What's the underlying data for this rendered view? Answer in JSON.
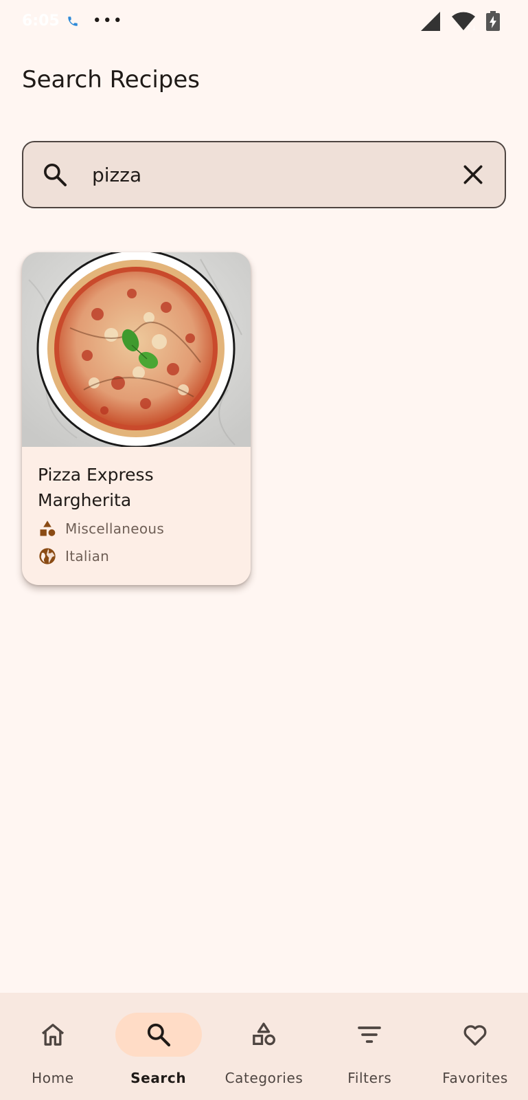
{
  "status_bar": {
    "time": "6:05",
    "call_icon": "phone-call-icon",
    "more_icon": "more-dots-icon",
    "signal_icon": "cell-signal-icon",
    "wifi_icon": "wifi-icon",
    "battery_icon": "battery-charging-icon"
  },
  "header": {
    "title": "Search Recipes"
  },
  "search": {
    "value": "pizza",
    "search_icon": "search-icon",
    "clear_icon": "close-icon"
  },
  "results": [
    {
      "title": "Pizza Express Margherita",
      "category": "Miscellaneous",
      "category_icon": "category-shapes-icon",
      "area": "Italian",
      "area_icon": "globe-icon"
    }
  ],
  "bottom_nav": {
    "items": [
      {
        "label": "Home",
        "icon": "home-icon",
        "active": false
      },
      {
        "label": "Search",
        "icon": "search-icon",
        "active": true
      },
      {
        "label": "Categories",
        "icon": "category-shapes-icon",
        "active": false
      },
      {
        "label": "Filters",
        "icon": "filter-icon",
        "active": false
      },
      {
        "label": "Favorites",
        "icon": "heart-icon",
        "active": false
      }
    ]
  },
  "colors": {
    "background": "#fff6f2",
    "search_fill": "#efe0d8",
    "card_fill": "#fdeee6",
    "nav_fill": "#f8e8e0",
    "active_pill": "#ffdcc6",
    "icon_brown": "#8a4b14"
  }
}
